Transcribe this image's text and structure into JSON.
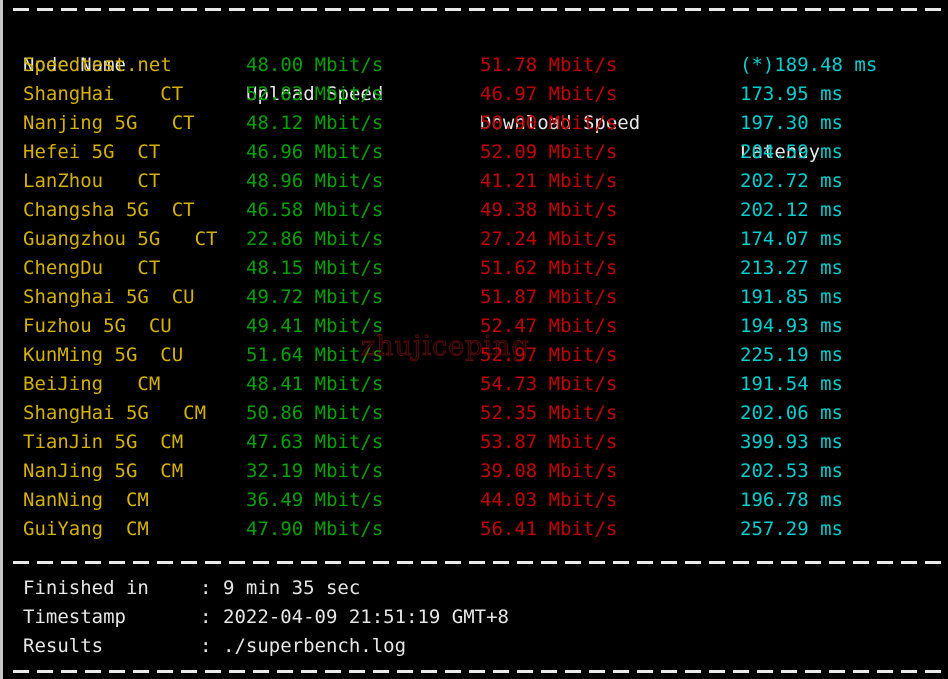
{
  "terminal": {
    "background_color": "#000000",
    "border_color": "#c8c8c8",
    "watermark": "zhujiceping"
  },
  "colors": {
    "header": "#e6e6e6",
    "node": "#d4b100",
    "upload": "#00a000",
    "download": "#c00000",
    "latency": "#00cdcd",
    "footer": "#e6e6e6",
    "rule": "#e8e8e8"
  },
  "table": {
    "headers": {
      "node": "Node Name",
      "upload": "Upload Speed",
      "download": "Download Speed",
      "latency": "Latency"
    },
    "rows": [
      {
        "node": "Speedtest.net",
        "upload": "48.00 Mbit/s",
        "download": "51.78 Mbit/s",
        "latency": "(*)189.48 ms"
      },
      {
        "node": "ShangHai    CT",
        "upload": "52.83 Mbit/s",
        "download": "46.97 Mbit/s",
        "latency": "173.95 ms"
      },
      {
        "node": "Nanjing 5G   CT",
        "upload": "48.12 Mbit/s",
        "download": "50.90 Mbit/s",
        "latency": "197.30 ms"
      },
      {
        "node": "Hefei 5G  CT",
        "upload": "46.96 Mbit/s",
        "download": "52.09 Mbit/s",
        "latency": "204.59 ms"
      },
      {
        "node": "LanZhou   CT",
        "upload": "48.96 Mbit/s",
        "download": "41.21 Mbit/s",
        "latency": "202.72 ms"
      },
      {
        "node": "Changsha 5G  CT",
        "upload": "46.58 Mbit/s",
        "download": "49.38 Mbit/s",
        "latency": "202.12 ms"
      },
      {
        "node": "Guangzhou 5G   CT",
        "upload": "22.86 Mbit/s",
        "download": "27.24 Mbit/s",
        "latency": "174.07 ms"
      },
      {
        "node": "ChengDu   CT",
        "upload": "48.15 Mbit/s",
        "download": "51.62 Mbit/s",
        "latency": "213.27 ms"
      },
      {
        "node": "Shanghai 5G  CU",
        "upload": "49.72 Mbit/s",
        "download": "51.87 Mbit/s",
        "latency": "191.85 ms"
      },
      {
        "node": "Fuzhou 5G  CU",
        "upload": "49.41 Mbit/s",
        "download": "52.47 Mbit/s",
        "latency": "194.93 ms"
      },
      {
        "node": "KunMing 5G  CU",
        "upload": "51.64 Mbit/s",
        "download": "52.97 Mbit/s",
        "latency": "225.19 ms"
      },
      {
        "node": "BeiJing   CM",
        "upload": "48.41 Mbit/s",
        "download": "54.73 Mbit/s",
        "latency": "191.54 ms"
      },
      {
        "node": "ShangHai 5G   CM",
        "upload": "50.86 Mbit/s",
        "download": "52.35 Mbit/s",
        "latency": "202.06 ms"
      },
      {
        "node": "TianJin 5G  CM",
        "upload": "47.63 Mbit/s",
        "download": "53.87 Mbit/s",
        "latency": "399.93 ms"
      },
      {
        "node": "NanJing 5G  CM",
        "upload": "32.19 Mbit/s",
        "download": "39.08 Mbit/s",
        "latency": "202.53 ms"
      },
      {
        "node": "NanNing  CM",
        "upload": "36.49 Mbit/s",
        "download": "44.03 Mbit/s",
        "latency": "196.78 ms"
      },
      {
        "node": "GuiYang  CM",
        "upload": "47.90 Mbit/s",
        "download": "56.41 Mbit/s",
        "latency": "257.29 ms"
      }
    ]
  },
  "footer": {
    "items": [
      {
        "label": "Finished in",
        "colon": ":",
        "value": "9 min 35 sec"
      },
      {
        "label": "Timestamp",
        "colon": ":",
        "value": "2022-04-09 21:51:19 GMT+8"
      },
      {
        "label": "Results",
        "colon": ":",
        "value": "./superbench.log"
      }
    ]
  }
}
